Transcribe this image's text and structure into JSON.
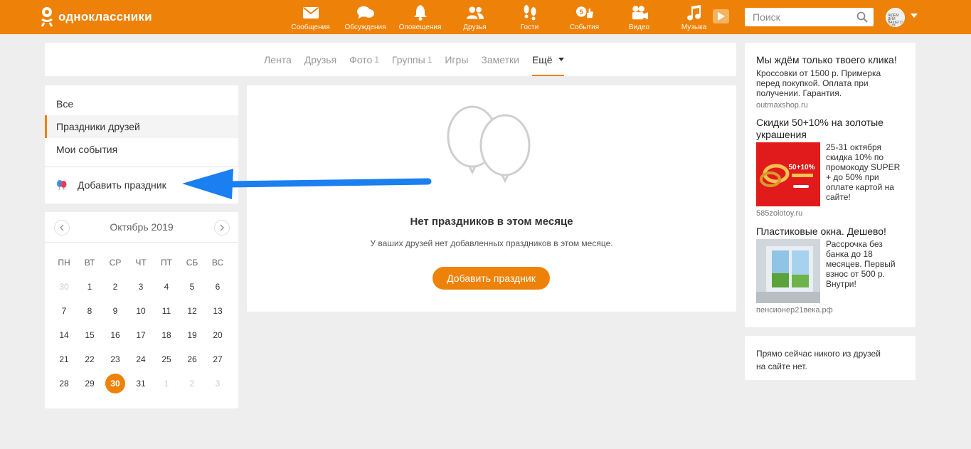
{
  "brand": {
    "name": "одноклассники"
  },
  "nav": [
    {
      "label": "Сообщения",
      "icon": "envelope-icon"
    },
    {
      "label": "Обсуждения",
      "icon": "chat-icon"
    },
    {
      "label": "Оповещения",
      "icon": "bell-icon"
    },
    {
      "label": "Друзья",
      "icon": "friends-icon"
    },
    {
      "label": "Гости",
      "icon": "footprints-icon"
    },
    {
      "label": "События",
      "icon": "events-icon",
      "badge": "5"
    },
    {
      "label": "Видео",
      "icon": "camera-icon"
    },
    {
      "label": "Музыка",
      "icon": "music-note-icon"
    }
  ],
  "search": {
    "placeholder": "Поиск"
  },
  "avatar": {
    "text": "ЖДЁМ ДНИ ВАШЕГО ДНЯ"
  },
  "tabs": [
    {
      "label": "Лента",
      "count": ""
    },
    {
      "label": "Друзья",
      "count": ""
    },
    {
      "label": "Фото",
      "count": "1"
    },
    {
      "label": "Группы",
      "count": "1"
    },
    {
      "label": "Игры",
      "count": ""
    },
    {
      "label": "Заметки",
      "count": ""
    },
    {
      "label": "Ещё",
      "count": ""
    }
  ],
  "menu": {
    "items": [
      "Все",
      "Праздники друзей",
      "Мои события"
    ],
    "active_index": 1,
    "add_label": "Добавить праздник"
  },
  "calendar": {
    "title": "Октябрь 2019",
    "weekdays": [
      "ПН",
      "ВТ",
      "СР",
      "ЧТ",
      "ПТ",
      "СБ",
      "ВС"
    ],
    "weeks": [
      [
        "30",
        "1",
        "2",
        "3",
        "4",
        "5",
        "6"
      ],
      [
        "7",
        "8",
        "9",
        "10",
        "11",
        "12",
        "13"
      ],
      [
        "14",
        "15",
        "16",
        "17",
        "18",
        "19",
        "20"
      ],
      [
        "21",
        "22",
        "23",
        "24",
        "25",
        "26",
        "27"
      ],
      [
        "28",
        "29",
        "30",
        "31",
        "1",
        "2",
        "3"
      ]
    ],
    "today": "30"
  },
  "empty": {
    "title": "Нет праздников в этом месяце",
    "text": "У ваших друзей нет добавленных праздников в этом месяце.",
    "button": "Добавить праздник"
  },
  "ads": [
    {
      "title": "Мы ждём только твоего клика!",
      "body": "Кроссовки от 1500 р. Примерка перед покупкой. Оплата при получении. Гарантия.",
      "source": "outmaxshop.ru"
    },
    {
      "title": "Скидки 50+10% на золотые украшения",
      "body": "25-31 октября скидка 10% по промокоду SUPER + до 50% при оплате картой на сайте!",
      "source": "585zolotoy.ru",
      "image_text": "50+10%"
    },
    {
      "title": "Пластиковые окна. Дешево!",
      "body": "Рассрочка без банка до 18 месяцев. Первый взнос от 500 р. Внутри!",
      "source": "пенсионер21века.рф"
    }
  ],
  "friends_online": {
    "text": "Прямо сейчас никого из друзей на сайте нет."
  },
  "colors": {
    "brand": "#ee8208",
    "arrow": "#1a7ff0"
  }
}
